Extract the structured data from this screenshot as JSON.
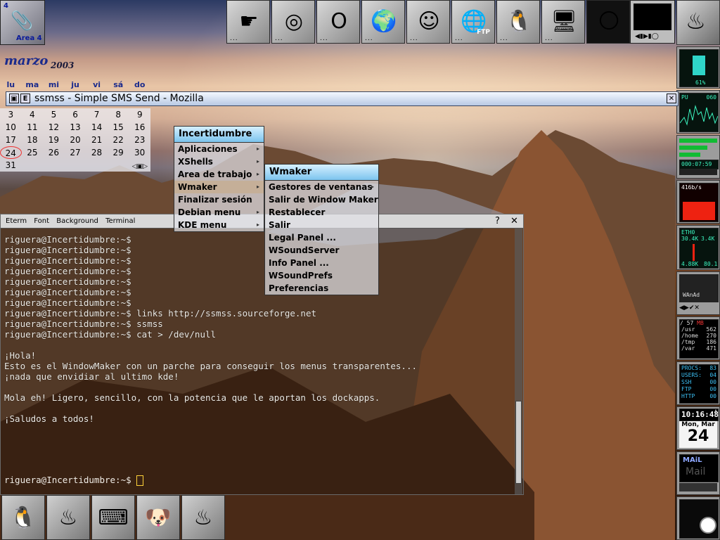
{
  "workspace": {
    "number": "4",
    "label": "Area 4"
  },
  "top_dock": {
    "items": [
      {
        "name": "pointing-hand-icon",
        "glyph": "☛"
      },
      {
        "name": "spiral-icon",
        "glyph": "◎"
      },
      {
        "name": "opera-icon",
        "glyph": "O"
      },
      {
        "name": "globe-icon",
        "glyph": "🌍"
      },
      {
        "name": "gaim-icon",
        "glyph": "☺"
      },
      {
        "name": "ftp-icon",
        "glyph": "🌐",
        "label": "FTP"
      },
      {
        "name": "linux-terminal-icon",
        "glyph": "🐧"
      },
      {
        "name": "monitor-icon",
        "glyph": "🖥"
      },
      {
        "name": "floppy-icon",
        "glyph": "💾"
      },
      {
        "name": "moon-icon",
        "glyph": "🌕"
      }
    ],
    "dots": "..."
  },
  "calendar": {
    "month": "marzo",
    "year": "2003",
    "weekdays": [
      "lu",
      "ma",
      "mi",
      "ju",
      "vi",
      "sá",
      "do"
    ],
    "rows": [
      [
        "3",
        "4",
        "5",
        "6",
        "7",
        "8",
        "9"
      ],
      [
        "10",
        "11",
        "12",
        "13",
        "14",
        "15",
        "16"
      ],
      [
        "17",
        "18",
        "19",
        "20",
        "21",
        "22",
        "23"
      ],
      [
        "24",
        "25",
        "26",
        "27",
        "28",
        "29",
        "30"
      ],
      [
        "31",
        "",
        "",
        "",
        "",
        "",
        ""
      ]
    ],
    "today": "24",
    "nav": "◁▣▷"
  },
  "mozilla_window": {
    "title": "ssmss - Simple SMS Send - Mozilla",
    "min_label": "",
    "menu_label": "E",
    "close_label": "✕"
  },
  "terminal": {
    "menu": [
      "Eterm",
      "Font",
      "Background",
      "Terminal"
    ],
    "help": "?",
    "close": "✕",
    "lines": [
      "riguera@Incertidumbre:~$",
      "riguera@Incertidumbre:~$",
      "riguera@Incertidumbre:~$",
      "riguera@Incertidumbre:~$",
      "riguera@Incertidumbre:~$",
      "riguera@Incertidumbre:~$",
      "riguera@Incertidumbre:~$",
      "riguera@Incertidumbre:~$ links http://ssmss.sourceforge.net",
      "riguera@Incertidumbre:~$ ssmss",
      "riguera@Incertidumbre:~$ cat > /dev/null",
      "",
      "¡Hola!",
      "Esto es el WindowMaker con un parche para conseguir los menus transparentes...",
      "¡nada que envidiar al ultimo kde!",
      "",
      "Mola eh! Ligero, sencillo, con la potencia que le aportan los dockapps.",
      "",
      "¡Saludos a todos!"
    ],
    "prompt": "riguera@Incertidumbre:~$"
  },
  "root_menu": {
    "title": "Incertidumbre",
    "items": [
      {
        "label": "Aplicaciones",
        "sub": true
      },
      {
        "label": "XShells",
        "sub": true
      },
      {
        "label": "Area de trabajo",
        "sub": true
      },
      {
        "label": "Wmaker",
        "sub": true
      },
      {
        "label": "Finalizar sesión",
        "sub": false
      },
      {
        "label": "Debian menu",
        "sub": true
      },
      {
        "label": "KDE menu",
        "sub": true
      }
    ]
  },
  "wmaker_menu": {
    "title": "Wmaker",
    "items": [
      {
        "label": "Gestores de ventanas",
        "sub": true
      },
      {
        "label": "Salir de Window Maker",
        "sub": false
      },
      {
        "label": "Restablecer",
        "sub": false
      },
      {
        "label": "Salir",
        "sub": false
      },
      {
        "label": "Legal Panel ...",
        "sub": false
      },
      {
        "label": "WSoundServer",
        "sub": false
      },
      {
        "label": "Info Panel ...",
        "sub": false
      },
      {
        "label": "WSoundPrefs",
        "sub": false
      },
      {
        "label": "Preferencias",
        "sub": false
      }
    ]
  },
  "right_dock": {
    "battery_pct": "61%",
    "cpu_label": "PU",
    "cpu_val": "060",
    "uptime": "000:07:59",
    "net_rate": "416b/s",
    "eth_label": "ETH0",
    "eth_vals": [
      "30.4K",
      "3.4K",
      "4.88K",
      "80.1"
    ],
    "mixer_label": "WAnAd",
    "disk_header": [
      "/",
      "57",
      "MB"
    ],
    "disk_rows": [
      [
        "/usr",
        "562"
      ],
      [
        "/home",
        "270"
      ],
      [
        "/tmp",
        "186"
      ],
      [
        "/var",
        "471"
      ]
    ],
    "procs": [
      [
        "PROCS:",
        "83"
      ],
      [
        "USERS:",
        "04"
      ],
      [
        "SSH",
        "00"
      ],
      [
        "FTP",
        "00"
      ],
      [
        "HTTP",
        "00"
      ]
    ],
    "clock": "10:16:48",
    "clock_ampm": "A",
    "date_day": "Mon, Mar",
    "date_num": "24",
    "mail_label": "MAiL",
    "mail_sub": "Mail"
  },
  "bottom_dock": {
    "items": [
      {
        "name": "xterm-tux-icon",
        "glyph": "🐧"
      },
      {
        "name": "wmaker-logo-icon",
        "glyph": "♨"
      },
      {
        "name": "eterm-icon",
        "glyph": "⌨"
      },
      {
        "name": "gimp-icon",
        "glyph": "🐶"
      },
      {
        "name": "wmaker-logo-icon-2",
        "glyph": "♨"
      }
    ]
  },
  "colors": {
    "menu_title": "#7cc4ee",
    "moz_title": "#b8c9e4",
    "lcd": "#3cf5c0"
  }
}
